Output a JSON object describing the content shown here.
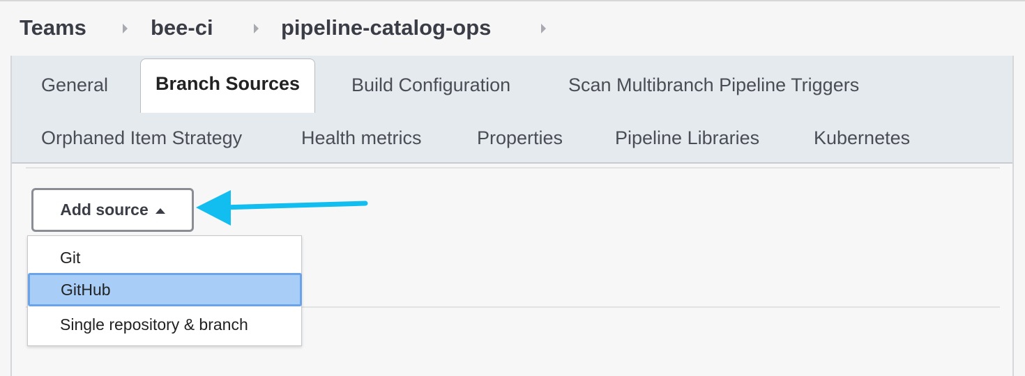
{
  "breadcrumb": {
    "items": [
      "Teams",
      "bee-ci",
      "pipeline-catalog-ops"
    ]
  },
  "tabs": {
    "row1": [
      "General",
      "Branch Sources",
      "Build Configuration",
      "Scan Multibranch Pipeline Triggers"
    ],
    "row2": [
      "Orphaned Item Strategy",
      "Health metrics",
      "Properties",
      "Pipeline Libraries",
      "Kubernetes"
    ],
    "active": "Branch Sources"
  },
  "add_source": {
    "label": "Add source"
  },
  "dropdown": {
    "options": [
      "Git",
      "GitHub",
      "Single repository & branch"
    ],
    "highlighted": "GitHub"
  },
  "colors": {
    "annotation_arrow": "#12bdf0",
    "highlight_bg": "#a8cef8",
    "highlight_border": "#6ba3e8"
  },
  "icons": {
    "breadcrumb_separator": "chevron-right-icon",
    "button_caret": "caret-up-icon",
    "annotation": "arrow-left-icon"
  }
}
